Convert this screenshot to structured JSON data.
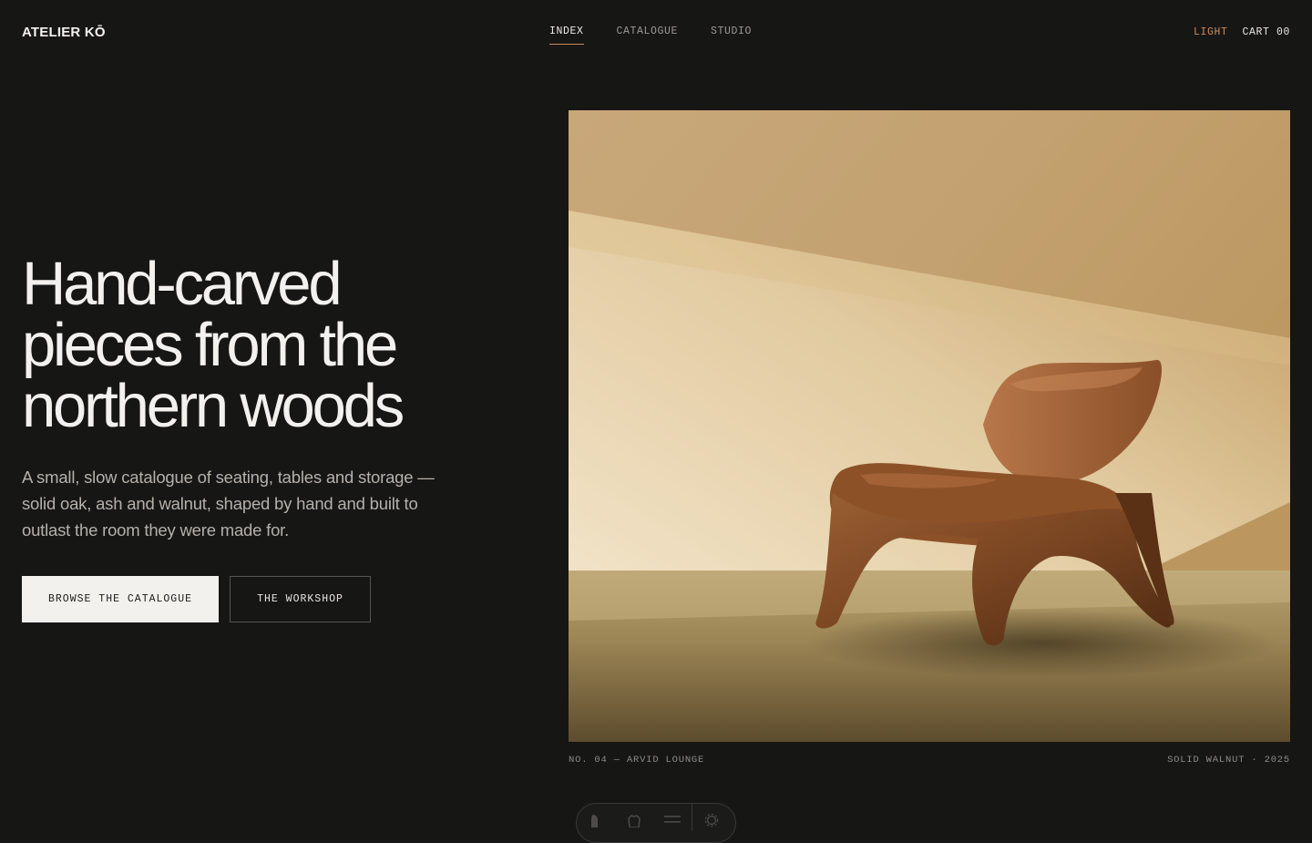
{
  "header": {
    "brand": "ATELIER KŌ",
    "nav": [
      {
        "label": "INDEX",
        "active": true
      },
      {
        "label": "CATALOGUE",
        "active": false
      },
      {
        "label": "STUDIO",
        "active": false
      }
    ],
    "theme_toggle": "LIGHT",
    "cart": "CART 00"
  },
  "hero": {
    "headline_lines": [
      "Hand-carved",
      "pieces from the",
      "northern woods"
    ],
    "subtext": "A small, slow catalogue of seating, tables and storage — solid oak, ash and walnut, shaped by hand and built to outlast the room they were made for.",
    "primary_cta": "BROWSE THE CATALOGUE",
    "secondary_cta": "THE WORKSHOP",
    "caption_left": "NO. 04 — ARVID LOUNGE",
    "caption_right": "SOLID WALNUT · 2025"
  },
  "toolbar": {
    "icons": [
      "pointer-icon",
      "hand-icon",
      "menu-icon",
      "gear-icon"
    ]
  },
  "colors": {
    "background": "#161615",
    "accent": "#c98a56",
    "text": "#f3f1ed",
    "muted": "#9d9a94"
  }
}
